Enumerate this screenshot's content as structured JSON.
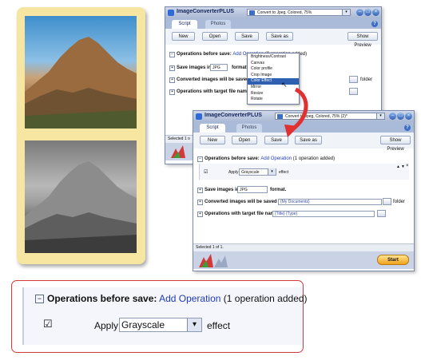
{
  "app": {
    "title": "ImageConverterPLUS",
    "preset_before": "Convert to Jpeg, Colored, 75%",
    "preset_after": "Convert to Jpeg, Colored, 75% (2)*",
    "help": "?"
  },
  "tabs": {
    "script": "Script",
    "photos": "Photos"
  },
  "toolbar": {
    "new": "New",
    "open": "Open",
    "save": "Save",
    "save_as": "Save as",
    "show_preview": "Show Preview"
  },
  "rows": {
    "operations_label": "Operations before save:",
    "add_operation": "Add Operation",
    "ops_none": "(0 operation added)",
    "ops_one": "(1 operation added)",
    "save_in_label": "Save images in",
    "format_value": "JPG",
    "format_suffix": "format.",
    "format_suffix_cut": "format",
    "saved_to_label": "Converted images will be saved to",
    "saved_to_label_cut": "Converted images will be saved to",
    "saved_to_value": "{My Documents}",
    "folder": "folder",
    "target_name_label": "Operations with target file name",
    "target_name_value": "{Title} {Type}"
  },
  "operation": {
    "apply": "Apply",
    "effect_value": "Grayscale",
    "effect_suffix": "effect"
  },
  "status": {
    "selected_cut": "Selected 1 o",
    "selected": "Selected 1 of 1."
  },
  "start": "Start",
  "menu": {
    "items": [
      "Brightness/Contrast",
      "Canvas",
      "Color profile",
      "Crop Image",
      "Color Effect",
      "Mirror",
      "Resize",
      "Rotate"
    ],
    "selected": "Color Effect"
  },
  "colors": {
    "accent": "#2f5fb0",
    "callout_border": "#d23a3a",
    "card": "#f7e6a2",
    "start": "#f2a21c"
  }
}
